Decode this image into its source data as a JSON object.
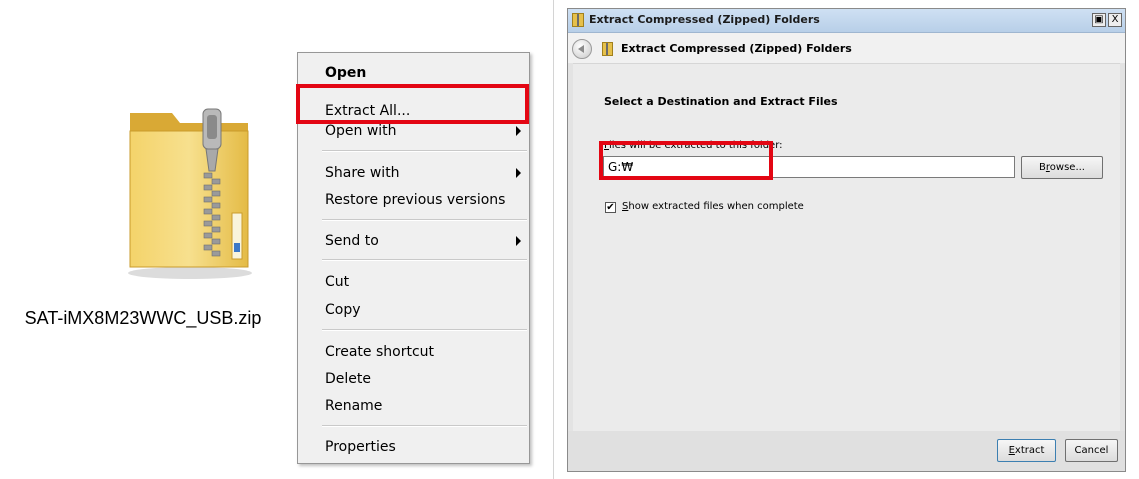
{
  "file": {
    "name": "SAT-iMX8M23WWC_USB.zip",
    "icon": "zip-folder-icon"
  },
  "context_menu": {
    "items": [
      {
        "label": "Open",
        "bold": true
      },
      {
        "label": "Extract All..."
      },
      {
        "label": "Open with",
        "submenu": true
      },
      {
        "label": "Share with",
        "submenu": true
      },
      {
        "label": "Restore previous versions"
      },
      {
        "label": "Send to",
        "submenu": true
      },
      {
        "label": "Cut"
      },
      {
        "label": "Copy"
      },
      {
        "label": "Create shortcut"
      },
      {
        "label": "Delete"
      },
      {
        "label": "Rename"
      },
      {
        "label": "Properties"
      }
    ]
  },
  "dialog": {
    "window_title": "Extract Compressed (Zipped) Folders",
    "nav_title": "Extract Compressed (Zipped) Folders",
    "heading": "Select a Destination and Extract Files",
    "files_label": "Files will be extracted to this folder:",
    "destination": "G:₩",
    "browse_label": "Browse...",
    "show_files_label": "Show extracted files when complete",
    "show_files_checked": true,
    "extract_label": "Extract",
    "cancel_label": "Cancel",
    "restore_button": "▣",
    "close_button": "X"
  },
  "colors": {
    "highlight": "#e30613",
    "dialog_background": "#e3e3e3",
    "menu_background": "#f0f0f0"
  }
}
